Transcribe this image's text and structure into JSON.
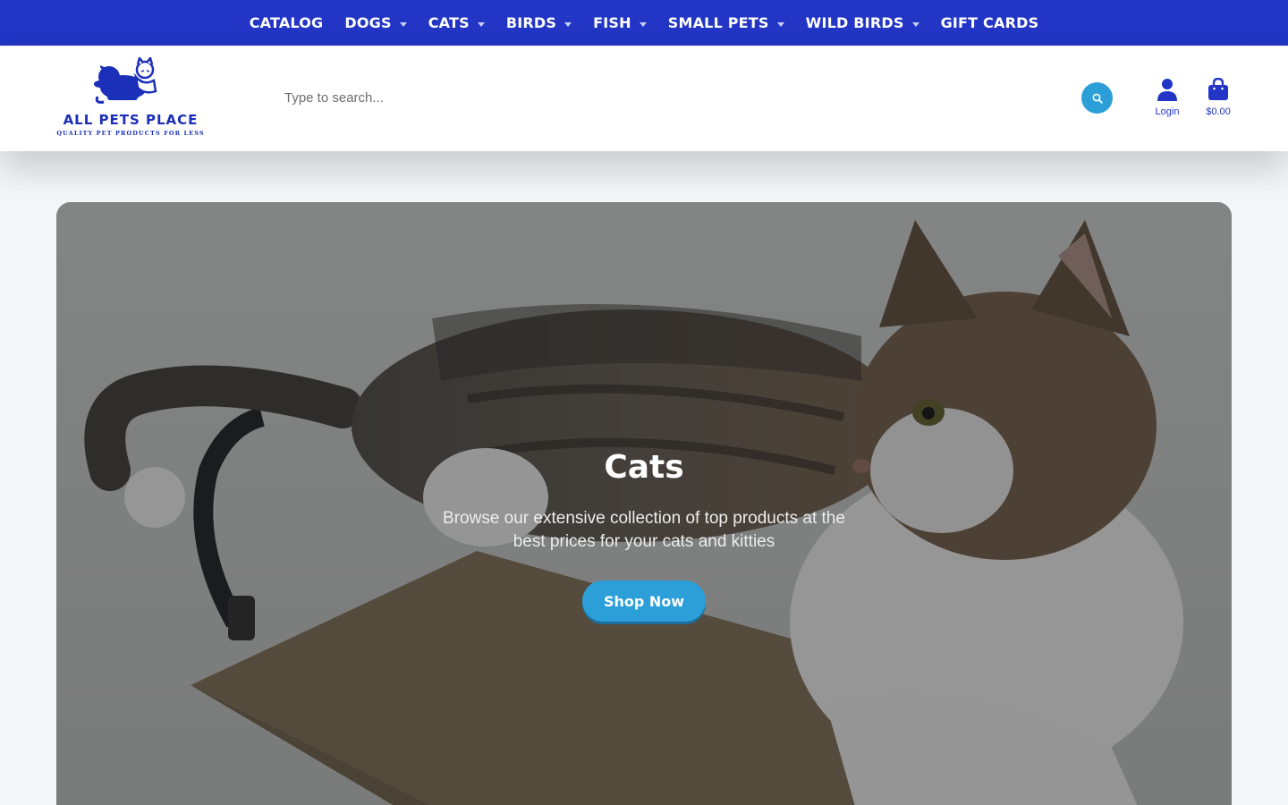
{
  "nav": {
    "items": [
      {
        "label": "CATALOG",
        "dropdown": false
      },
      {
        "label": "DOGS",
        "dropdown": true
      },
      {
        "label": "CATS",
        "dropdown": true
      },
      {
        "label": "BIRDS",
        "dropdown": true
      },
      {
        "label": "FISH",
        "dropdown": true
      },
      {
        "label": "SMALL PETS",
        "dropdown": true
      },
      {
        "label": "WILD BIRDS",
        "dropdown": true
      },
      {
        "label": "GIFT CARDS",
        "dropdown": false
      }
    ]
  },
  "header": {
    "logo_name": "ALL PETS PLACE",
    "logo_tagline": "QUALITY PET PRODUCTS FOR LESS",
    "search_placeholder": "Type to search...",
    "search_icon": "search-icon",
    "login_label": "Login",
    "login_icon": "user-icon",
    "cart_amount": "$0.00",
    "cart_icon": "shopping-bag-icon"
  },
  "hero": {
    "title": "Cats",
    "subtitle": "Browse our extensive collection of top products at the best prices for your cats and kitties",
    "button_label": "Shop Now"
  },
  "colors": {
    "nav_bg": "#2235c4",
    "brand_blue": "#1b2fb8",
    "accent": "#2d9fd8"
  }
}
